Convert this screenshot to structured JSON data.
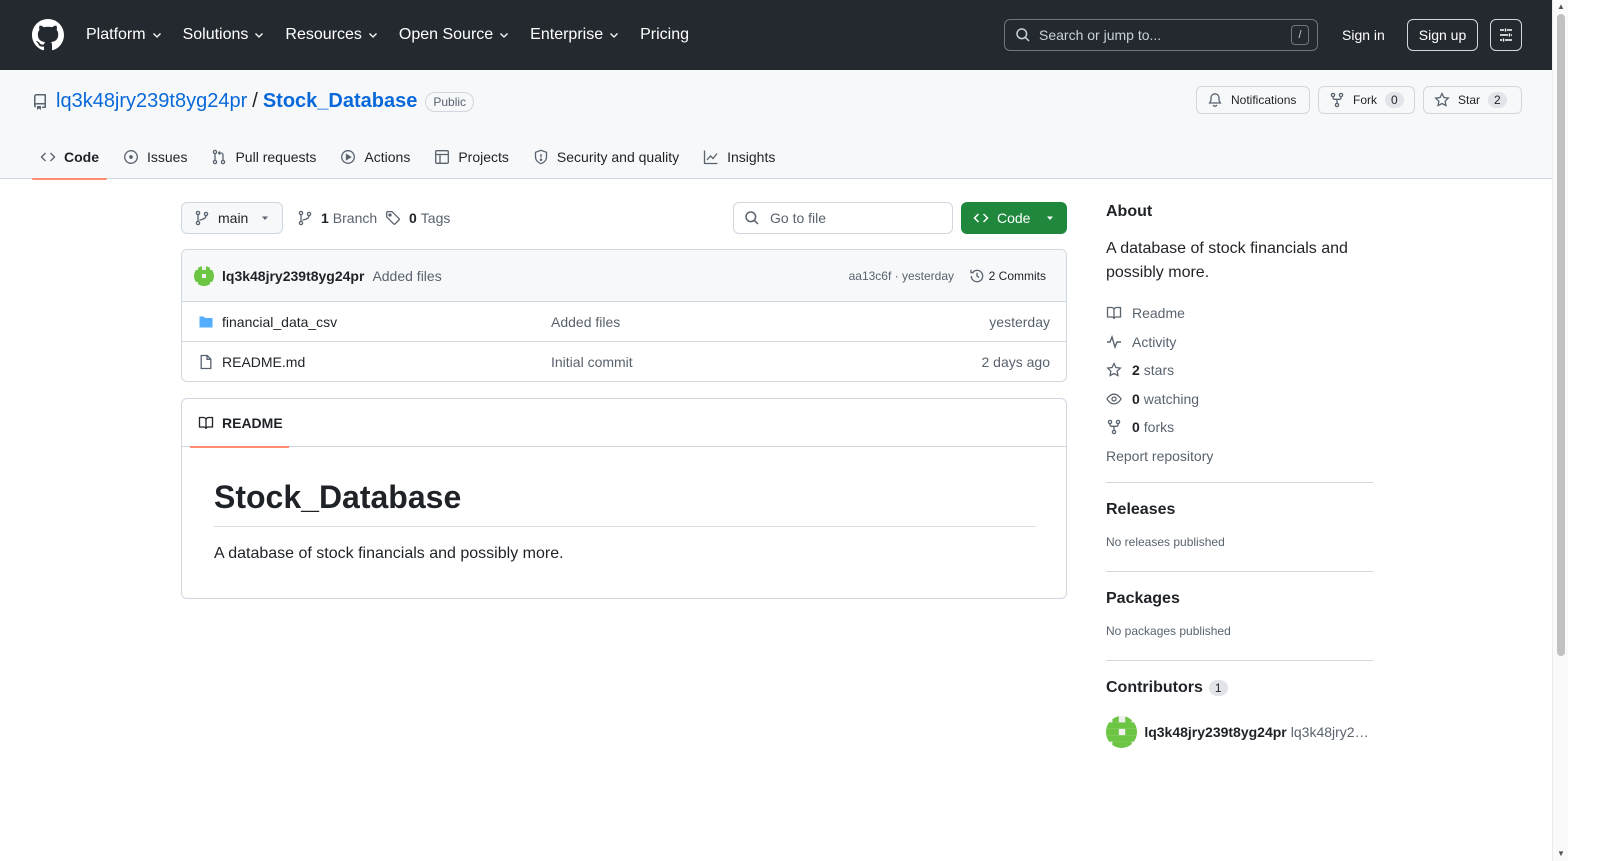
{
  "header": {
    "nav": [
      {
        "label": "Platform",
        "dropdown": true
      },
      {
        "label": "Solutions",
        "dropdown": true
      },
      {
        "label": "Resources",
        "dropdown": true
      },
      {
        "label": "Open Source",
        "dropdown": true
      },
      {
        "label": "Enterprise",
        "dropdown": true
      },
      {
        "label": "Pricing",
        "dropdown": false
      }
    ],
    "search_placeholder": "Search or jump to...",
    "search_key": "/",
    "signin": "Sign in",
    "signup": "Sign up"
  },
  "repo": {
    "owner": "lq3k48jry239t8yg24pr",
    "separator": "/",
    "name": "Stock_Database",
    "visibility": "Public",
    "notifications_label": "Notifications",
    "fork_label": "Fork",
    "fork_count": "0",
    "star_label": "Star",
    "star_count": "2",
    "tabs": [
      {
        "label": "Code",
        "active": true
      },
      {
        "label": "Issues"
      },
      {
        "label": "Pull requests"
      },
      {
        "label": "Actions"
      },
      {
        "label": "Projects"
      },
      {
        "label": "Security and quality"
      },
      {
        "label": "Insights"
      }
    ]
  },
  "toolbar": {
    "branch": "main",
    "branch_count": "1",
    "branch_label": "Branch",
    "tag_count": "0",
    "tag_label": "Tags",
    "goto_placeholder": "Go to file",
    "code_label": "Code"
  },
  "commit": {
    "author": "lq3k48jry239t8yg24pr",
    "message": "Added files",
    "meta": "aa13c6f · yesterday",
    "commits_label": "2 Commits"
  },
  "files": [
    {
      "name": "financial_data_csv",
      "type": "folder",
      "message": "Added files",
      "date": "yesterday"
    },
    {
      "name": "README.md",
      "type": "file",
      "message": "Initial commit",
      "date": "2 days ago"
    }
  ],
  "readme": {
    "tab_label": "README",
    "title": "Stock_Database",
    "description": "A database of stock financials and possibly more."
  },
  "sidebar": {
    "about_title": "About",
    "about_desc": "A database of stock financials and possibly more.",
    "readme": "Readme",
    "activity": "Activity",
    "stars_count": "2",
    "stars_label": "stars",
    "watching_count": "0",
    "watching_label": "watching",
    "forks_count": "0",
    "forks_label": "forks",
    "report": "Report repository",
    "releases_title": "Releases",
    "releases_empty": "No releases published",
    "packages_title": "Packages",
    "packages_empty": "No packages published",
    "contributors_title": "Contributors",
    "contributors_count": "1",
    "contributor_login": "lq3k48jry239t8yg24pr",
    "contributor_name": "lq3k48jry239t8yg24pr"
  },
  "colors": {
    "header_bg": "#24292f",
    "link": "#0969da",
    "primary_button": "#1f883d",
    "tab_underline": "#fd8c73",
    "folder_icon": "#54aeff",
    "avatar": "#6cc644"
  }
}
